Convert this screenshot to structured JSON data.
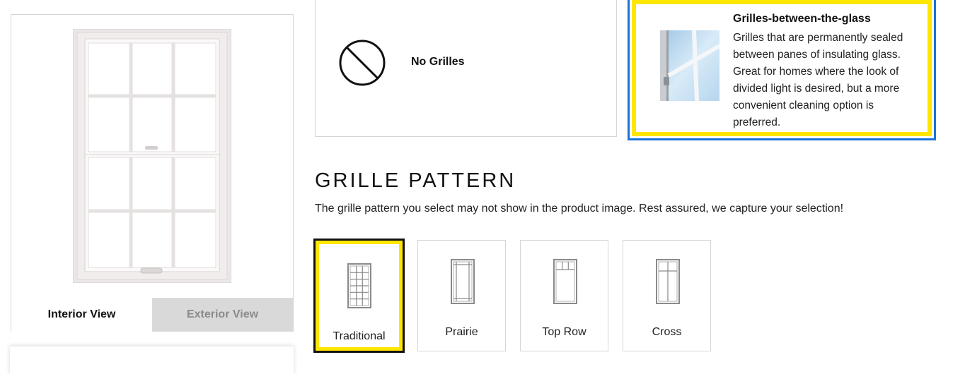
{
  "preview": {
    "interior_view_label": "Interior View",
    "exterior_view_label": "Exterior View",
    "active_view": "Interior View"
  },
  "grille_types": {
    "no_grilles": {
      "label": "No Grilles",
      "selected": false
    },
    "grilles_between_glass": {
      "title": "Grilles-between-the-glass",
      "description": "Grilles that are permanently sealed between panes of insulating glass. Great for homes where the look of divided light is desired, but a more convenient cleaning option is preferred.",
      "selected": true
    }
  },
  "grille_pattern": {
    "heading": "GRILLE PATTERN",
    "note": "The grille pattern you select may not show in the product image. Rest assured, we capture your selection!",
    "options": [
      {
        "label": "Traditional",
        "selected": true
      },
      {
        "label": "Prairie",
        "selected": false
      },
      {
        "label": "Top Row",
        "selected": false
      },
      {
        "label": "Cross",
        "selected": false
      }
    ]
  },
  "colors": {
    "selection_yellow": "#ffe600",
    "focus_blue": "#1a73d9",
    "border_gray": "#d6d6d6",
    "inactive_tab_bg": "#d9d9d9"
  }
}
